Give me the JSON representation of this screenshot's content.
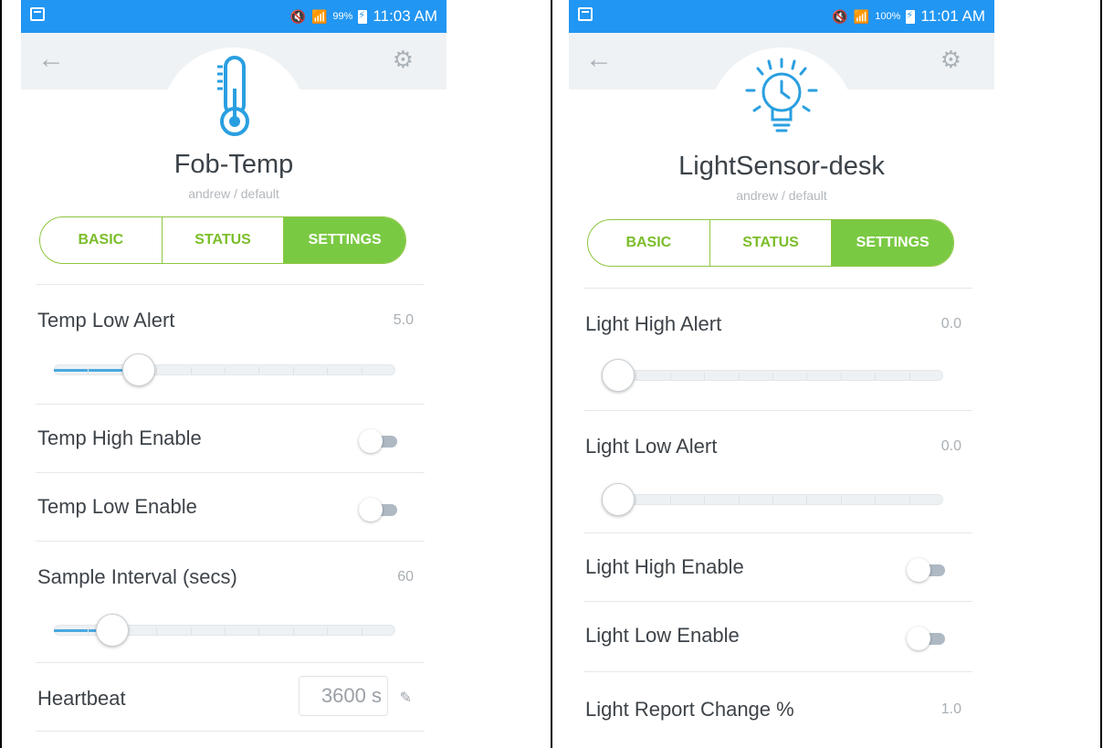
{
  "colors": {
    "statusbar": "#2196f3",
    "accent_green": "#7ac943",
    "accent_blue": "#3aa4de",
    "slider_fill": "#4aa8e0"
  },
  "left": {
    "statusbar": {
      "battery": "99%",
      "time": "11:03 AM"
    },
    "appbar": {
      "back_icon": "back-arrow-icon",
      "settings_icon": "gear-icon"
    },
    "device": {
      "icon": "thermometer-icon",
      "name": "Fob-Temp",
      "subtitle": "andrew / default"
    },
    "tabs": [
      {
        "label": "BASIC",
        "active": false
      },
      {
        "label": "STATUS",
        "active": false
      },
      {
        "label": "SETTINGS",
        "active": true
      }
    ],
    "settings": {
      "temp_low_alert": {
        "label": "Temp Low Alert",
        "value": "5.0",
        "slider_fraction": 0.21
      },
      "temp_high_enable": {
        "label": "Temp High Enable",
        "on": false
      },
      "temp_low_enable": {
        "label": "Temp Low Enable",
        "on": false
      },
      "sample_interval": {
        "label": "Sample Interval (secs)",
        "value": "60",
        "slider_fraction": 0.13
      },
      "heartbeat": {
        "label": "Heartbeat",
        "value": "3600 s",
        "edit_icon": "pencil-icon"
      }
    }
  },
  "right": {
    "statusbar": {
      "battery": "100%",
      "time": "11:01 AM"
    },
    "appbar": {
      "back_icon": "back-arrow-icon",
      "settings_icon": "gear-icon"
    },
    "device": {
      "icon": "lightbulb-icon",
      "name": "LightSensor-desk",
      "subtitle": "andrew / default"
    },
    "tabs": [
      {
        "label": "BASIC",
        "active": false
      },
      {
        "label": "STATUS",
        "active": false
      },
      {
        "label": "SETTINGS",
        "active": true
      }
    ],
    "settings": {
      "light_high_alert": {
        "label": "Light High Alert",
        "value": "0.0",
        "slider_fraction": 0.0
      },
      "light_low_alert": {
        "label": "Light Low Alert",
        "value": "0.0",
        "slider_fraction": 0.0
      },
      "light_high_enable": {
        "label": "Light High Enable",
        "on": false
      },
      "light_low_enable": {
        "label": "Light Low Enable",
        "on": false
      },
      "light_report_change": {
        "label": "Light Report Change %",
        "value": "1.0"
      }
    }
  }
}
